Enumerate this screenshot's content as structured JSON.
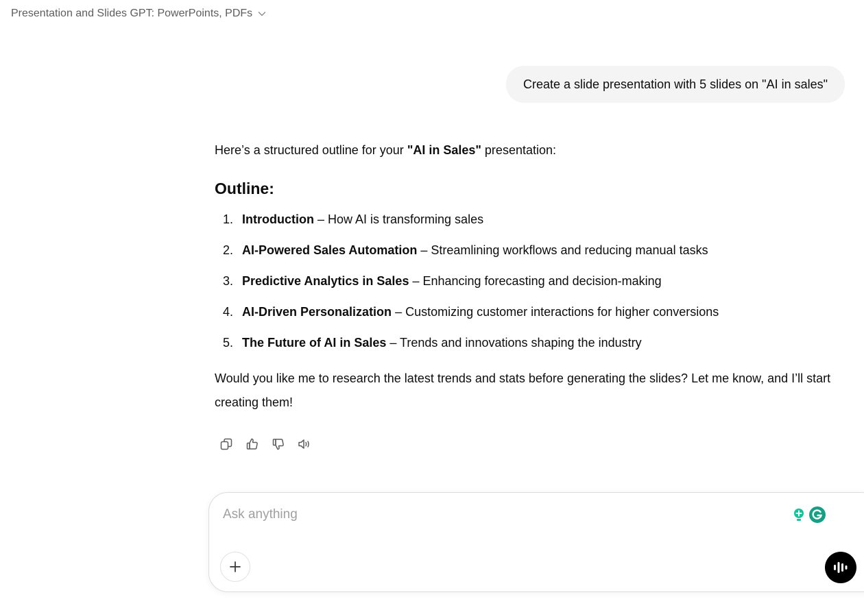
{
  "header": {
    "title": "Presentation and Slides GPT: PowerPoints, PDFs"
  },
  "user_message": "Create a slide presentation with 5 slides on \"AI in sales\"",
  "assistant": {
    "intro_prefix": "Here’s a structured outline for your ",
    "intro_bold": "\"AI in Sales\"",
    "intro_suffix": " presentation:",
    "heading": "Outline:",
    "items": [
      {
        "num": "1.",
        "title": "Introduction",
        "desc": " – How AI is transforming sales"
      },
      {
        "num": "2.",
        "title": "AI-Powered Sales Automation",
        "desc": " – Streamlining workflows and reducing manual tasks"
      },
      {
        "num": "3.",
        "title": "Predictive Analytics in Sales",
        "desc": " – Enhancing forecasting and decision-making"
      },
      {
        "num": "4.",
        "title": "AI-Driven Personalization",
        "desc": " – Customizing customer interactions for higher conversions"
      },
      {
        "num": "5.",
        "title": "The Future of AI in Sales",
        "desc": " – Trends and innovations shaping the industry"
      }
    ],
    "closing": "Would you like me to research the latest trends and stats before generating the slides? Let me know, and I’ll start creating them!"
  },
  "actions": [
    "copy-icon",
    "thumbs-up-icon",
    "thumbs-down-icon",
    "read-aloud-icon"
  ],
  "composer": {
    "placeholder": "Ask anything"
  },
  "colors": {
    "accent_green": "#15c39a",
    "grammarly_green": "#15a085",
    "bubble_bg": "#f4f4f4"
  }
}
